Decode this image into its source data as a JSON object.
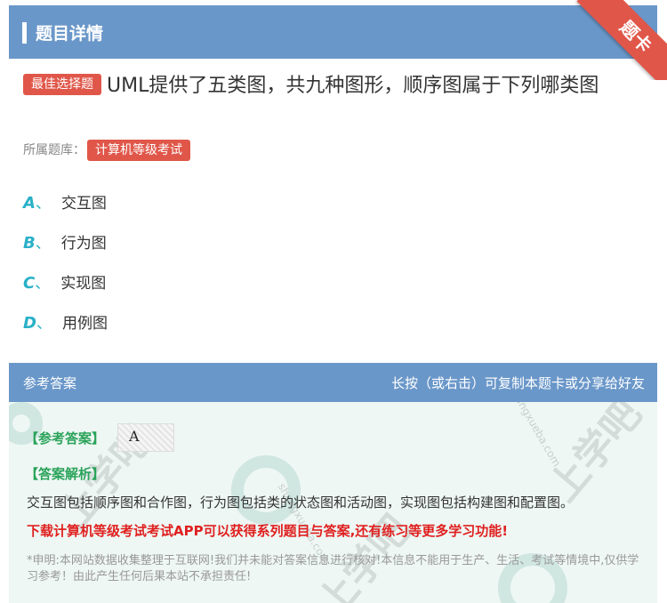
{
  "header": {
    "title": "题目详情",
    "corner_ribbon": "题卡"
  },
  "question": {
    "type_badge": "最佳选择题",
    "text": "UML提供了五类图，共九种图形，顺序图属于下列哪类图",
    "bank_label": "所属题库：",
    "bank_name": "计算机等级考试"
  },
  "options": [
    {
      "letter": "A",
      "sep": "、",
      "text": "交互图"
    },
    {
      "letter": "B",
      "sep": "、",
      "text": "行为图"
    },
    {
      "letter": "C",
      "sep": "、",
      "text": "实现图"
    },
    {
      "letter": "D",
      "sep": "、",
      "text": "用例图"
    }
  ],
  "answer": {
    "section_title": "参考答案",
    "share_hint": "长按（或右击）可复制本题卡或分享给好友",
    "reference_label": "【参考答案】",
    "reference_value": "A",
    "analysis_label": "【答案解析】",
    "analysis_text": "交互图包括顺序图和合作图，行为图包括类的状态图和活动图，实现图包括构建图和配置图。",
    "promo_text": "下载计算机等级考试考试APP可以获得系列题目与答案,还有练习等更多学习功能!",
    "disclaimer": "*申明:本网站数据收集整理于互联网!我们并未能对答案信息进行核对!本信息不能用于生产、生活、考试等情境中,仅供学习参考！由此产生任何后果本站不承担责任!"
  },
  "colors": {
    "header_bg": "#6a97c9",
    "accent_red": "#e0574a",
    "option_letter": "#2ab0c8",
    "answer_bg": "#eef7f3",
    "green_label": "#2aa35a",
    "promo_red": "#e02020"
  }
}
